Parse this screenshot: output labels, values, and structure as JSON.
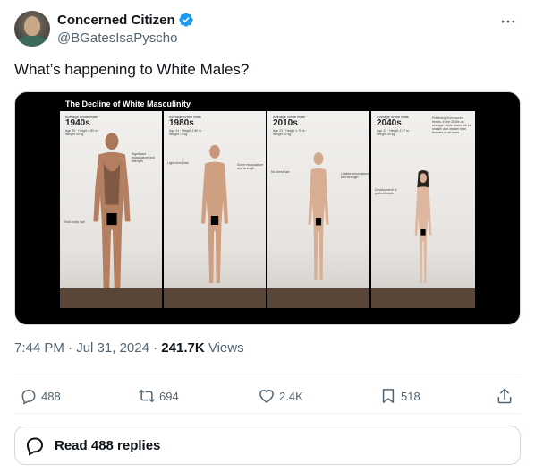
{
  "author": {
    "display_name": "Concerned Citizen",
    "handle": "@BGatesIsaPyscho",
    "verified": true
  },
  "tweet": {
    "text": "What’s happening to White Males?"
  },
  "media": {
    "title": "The Decline of White Masculinity",
    "panels": [
      {
        "label": "Average White Male",
        "era": "1940s",
        "stats": "Age 25 · Height 1.80 m · Weight 90 kg",
        "left_note": "Thick body hair",
        "right_note": "Significant musculature and strength"
      },
      {
        "label": "Average White Male",
        "era": "1980s",
        "stats": "Age 24 · Height 1.80 m · Weight 74 kg",
        "left_note": "Light chest hair",
        "right_note": "Some musculature and strength"
      },
      {
        "label": "Average White Male",
        "era": "2010s",
        "stats": "Age 23 · Height 1.78 m · Weight 62 kg",
        "left_note": "No chest hair",
        "right_note": "Limited musculature and strength"
      },
      {
        "label": "Average White Male",
        "era": "2040s",
        "stats": "Age 22 · Height 1.57 m · Weight 40 kg",
        "left_note": "Development of proto-breasts",
        "right_note": "Predicting from current trends, in the 2040s on average, white males will be smaller and weaker than females of all races."
      }
    ]
  },
  "meta": {
    "time": "7:44 PM",
    "separator": "·",
    "date": "Jul 31, 2024",
    "views_count": "241.7K",
    "views_label": "Views"
  },
  "actions": {
    "replies": "488",
    "reposts": "694",
    "likes": "2.4K",
    "bookmarks": "518"
  },
  "read_replies": {
    "label": "Read 488 replies"
  },
  "colors": {
    "text_primary": "#0f1419",
    "text_secondary": "#536471",
    "verified_blue": "#1d9bf0",
    "border": "#cfd9de",
    "divider": "#eff3f4"
  },
  "icons": {
    "verified": "verified-badge-icon",
    "more": "more-dots-icon",
    "reply": "reply-bubble-icon",
    "repost": "repost-arrows-icon",
    "like": "heart-icon",
    "bookmark": "bookmark-icon",
    "share": "share-upload-icon"
  }
}
